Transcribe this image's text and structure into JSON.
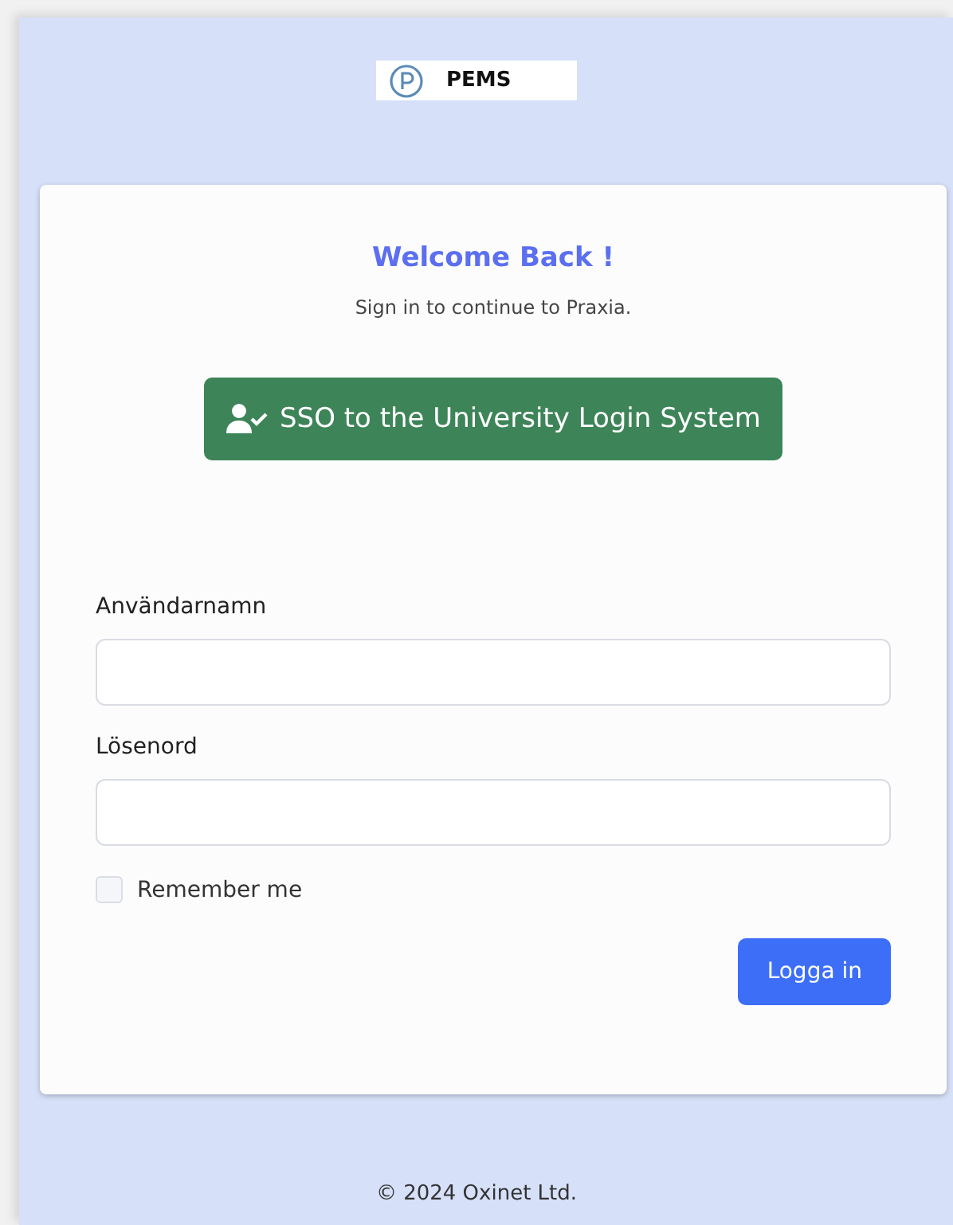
{
  "brand": {
    "name": "PEMS"
  },
  "card": {
    "title": "Welcome Back !",
    "subtitle": "Sign in to continue to Praxia.",
    "sso_button": "SSO to the University Login System",
    "fields": [
      {
        "label": "Användarnamn"
      },
      {
        "label": "Lösenord"
      }
    ],
    "remember": {
      "label": "Remember me",
      "checked": false
    },
    "submit": "Logga in"
  },
  "footer": "© 2024 Oxinet Ltd."
}
